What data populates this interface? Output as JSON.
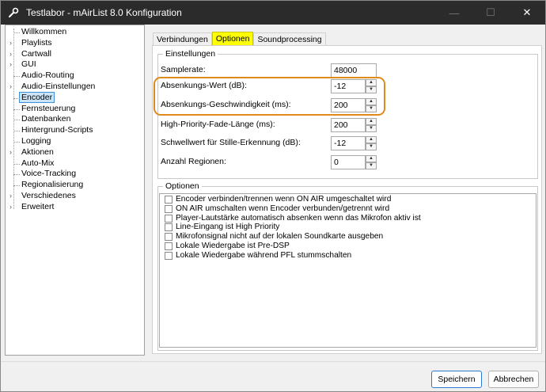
{
  "window": {
    "title": "Testlabor - mAirList 8.0 Konfiguration",
    "minimize_glyph": "—",
    "maximize_glyph": "☐",
    "close_glyph": "✕"
  },
  "sidebar": {
    "items": [
      {
        "label": "Willkommen",
        "expandable": false
      },
      {
        "label": "Playlists",
        "expandable": true
      },
      {
        "label": "Cartwall",
        "expandable": true
      },
      {
        "label": "GUI",
        "expandable": true
      },
      {
        "label": "Audio-Routing",
        "expandable": false
      },
      {
        "label": "Audio-Einstellungen",
        "expandable": true
      },
      {
        "label": "Encoder",
        "expandable": false,
        "selected": true
      },
      {
        "label": "Fernsteuerung",
        "expandable": false
      },
      {
        "label": "Datenbanken",
        "expandable": false
      },
      {
        "label": "Hintergrund-Scripts",
        "expandable": false
      },
      {
        "label": "Logging",
        "expandable": false
      },
      {
        "label": "Aktionen",
        "expandable": true
      },
      {
        "label": "Auto-Mix",
        "expandable": false
      },
      {
        "label": "Voice-Tracking",
        "expandable": false
      },
      {
        "label": "Regionalisierung",
        "expandable": false
      },
      {
        "label": "Verschiedenes",
        "expandable": true
      },
      {
        "label": "Erweitert",
        "expandable": true
      }
    ],
    "expand_glyph": "›"
  },
  "tabs": [
    {
      "label": "Verbindungen",
      "active": false
    },
    {
      "label": "Optionen",
      "active": true
    },
    {
      "label": "Soundprocessing",
      "active": false
    }
  ],
  "settings": {
    "group_title": "Einstellungen",
    "fields": [
      {
        "label": "Samplerate:",
        "value": "48000",
        "spinner": false
      },
      {
        "label": "Absenkungs-Wert (dB):",
        "value": "-12",
        "spinner": true
      },
      {
        "label": "Absenkungs-Geschwindigkeit (ms):",
        "value": "200",
        "spinner": true
      },
      {
        "label": "High-Priority-Fade-Länge (ms):",
        "value": "200",
        "spinner": true
      },
      {
        "label": "Schwellwert für Stille-Erkennung (dB):",
        "value": "-12",
        "spinner": true
      },
      {
        "label": "Anzahl Regionen:",
        "value": "0",
        "spinner": true
      }
    ],
    "spin_up": "▲",
    "spin_down": "▼"
  },
  "options": {
    "group_title": "Optionen",
    "items": [
      {
        "label": "Encoder verbinden/trennen wenn ON AIR umgeschaltet wird",
        "checked": false
      },
      {
        "label": "ON AIR umschalten wenn Encoder verbunden/getrennt wird",
        "checked": false
      },
      {
        "label": "Player-Lautstärke automatisch absenken wenn das Mikrofon aktiv ist",
        "checked": false
      },
      {
        "label": "Line-Eingang ist High Priority",
        "checked": false
      },
      {
        "label": "Mikrofonsignal nicht auf der lokalen Soundkarte ausgeben",
        "checked": false
      },
      {
        "label": "Lokale Wiedergabe ist Pre-DSP",
        "checked": false
      },
      {
        "label": "Lokale Wiedergabe während PFL stummschalten",
        "checked": false
      }
    ]
  },
  "buttons": {
    "save_label": "Speichern",
    "cancel_label": "Abbrechen"
  },
  "colors": {
    "active_tab": "#ffff00",
    "highlight_outline": "#e08a1e",
    "selection": "#cce4f7",
    "titlebar": "#2b2b2b"
  }
}
